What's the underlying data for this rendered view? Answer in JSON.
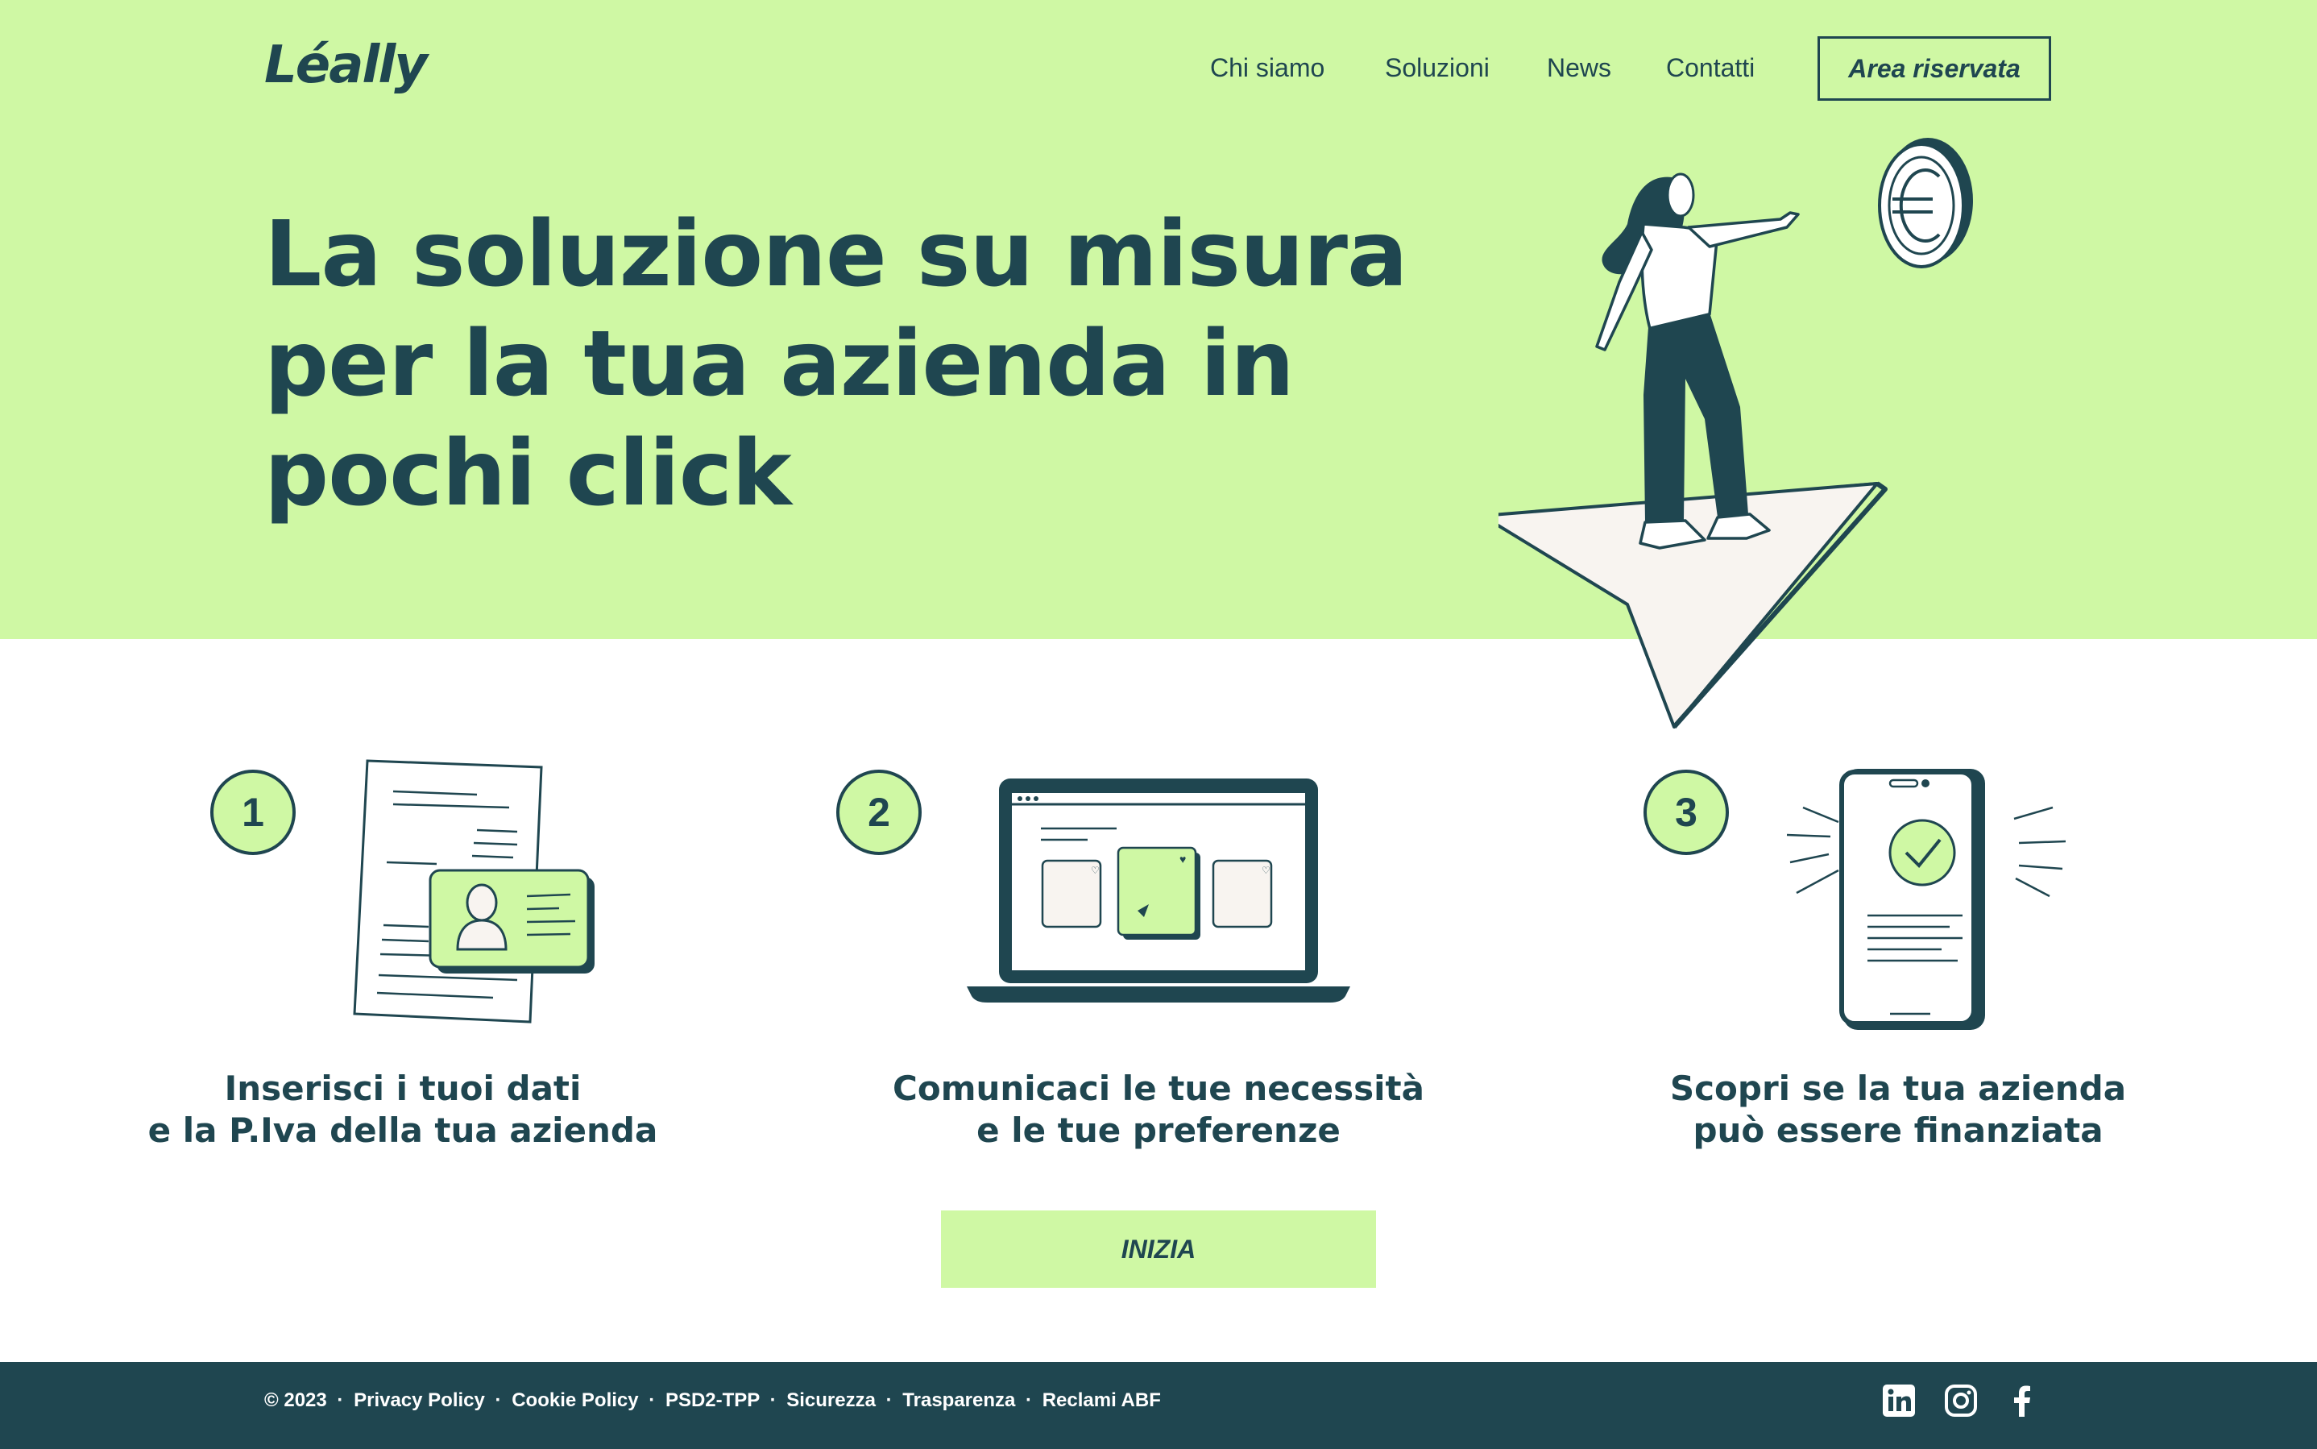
{
  "brand": {
    "name": "Léally"
  },
  "nav": {
    "items": [
      "Chi siamo",
      "Soluzioni",
      "News",
      "Contatti"
    ],
    "reserved_area": "Area riservata"
  },
  "hero": {
    "headline_lines": [
      "La soluzione su misura",
      "per la tua azienda in",
      "pochi click"
    ]
  },
  "steps": [
    {
      "number": "1",
      "lines": [
        "Inserisci i tuoi dati",
        "e la P.Iva della tua azienda"
      ],
      "illustration": "id-card-document-icon"
    },
    {
      "number": "2",
      "lines": [
        "Comunicaci le tue necessità",
        "e le tue preferenze"
      ],
      "illustration": "laptop-cards-icon"
    },
    {
      "number": "3",
      "lines": [
        "Scopri se la tua azienda",
        "può essere finanziata"
      ],
      "illustration": "phone-check-icon"
    }
  ],
  "cta": {
    "label": "INIZIA"
  },
  "footer": {
    "copyright": "© 2023",
    "separator": "·",
    "links": [
      "Privacy Policy",
      "Cookie Policy",
      "PSD2-TPP",
      "Sicurezza",
      "Trasparenza",
      "Reclami ABF"
    ],
    "social": [
      "linkedin-icon",
      "instagram-icon",
      "facebook-icon"
    ]
  },
  "colors": {
    "hero_bg": "#cff8a4",
    "primary": "#1f4650",
    "footer_bg": "#1f4650",
    "paper": "#f8f4f0",
    "white": "#ffffff"
  }
}
